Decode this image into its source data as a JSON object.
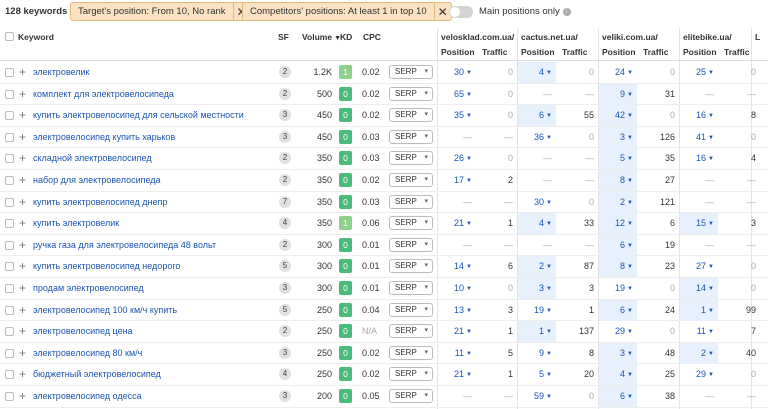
{
  "toolbar": {
    "keywords_count": "128 keywords",
    "filter1": "Target's position: From 10, No rank",
    "filter2": "Competitors' positions: At least 1 in top 10",
    "main_positions_label": "Main positions only",
    "main_positions_on": false
  },
  "columns": {
    "keyword": "Keyword",
    "sf": "SF",
    "volume": "Volume",
    "kd": "KD",
    "cpc": "CPC",
    "position": "Position",
    "traffic": "Traffic",
    "competitors": [
      "velosklad.com.ua/",
      "cactus.net.ua/",
      "veliki.com.ua/",
      "elitebike.ua/",
      "L"
    ]
  },
  "colors": {
    "kd_green": "#4bbb7c",
    "kd_lightgreen": "#8fd08f",
    "highlight": "#e6f1fd",
    "link": "#1a55b3"
  },
  "rows": [
    {
      "kw": "электровелик",
      "sf": "2",
      "vol": "1.2K",
      "kd": "1",
      "kdc": "lg",
      "cpc": "0.02",
      "serp": "SERP",
      "c": [
        [
          "30",
          0,
          "0"
        ],
        [
          "4",
          1,
          "0"
        ],
        [
          "24",
          0,
          "0"
        ],
        [
          "25",
          0,
          "0"
        ],
        [
          "",
          0,
          ""
        ]
      ]
    },
    {
      "kw": "комплект для электровелосипеда",
      "sf": "2",
      "vol": "500",
      "kd": "0",
      "kdc": "g",
      "cpc": "0.02",
      "serp": "SERP",
      "c": [
        [
          "65",
          0,
          "0"
        ],
        [
          "—",
          0,
          "—"
        ],
        [
          "9",
          1,
          "31"
        ],
        [
          "—",
          0,
          "—"
        ],
        [
          "",
          0,
          ""
        ]
      ]
    },
    {
      "kw": "купить электровелосипед для сельской местности",
      "sf": "3",
      "vol": "450",
      "kd": "0",
      "kdc": "g",
      "cpc": "0.02",
      "serp": "SERP",
      "c": [
        [
          "35",
          0,
          "0"
        ],
        [
          "6",
          1,
          "55"
        ],
        [
          "42",
          1,
          "0"
        ],
        [
          "16",
          0,
          "8"
        ],
        [
          "",
          0,
          ""
        ]
      ]
    },
    {
      "kw": "электровелосипед купить харьков",
      "sf": "3",
      "vol": "450",
      "kd": "0",
      "kdc": "g",
      "cpc": "0.03",
      "serp": "SERP",
      "c": [
        [
          "—",
          0,
          "—"
        ],
        [
          "36",
          0,
          "0"
        ],
        [
          "3",
          1,
          "126"
        ],
        [
          "41",
          0,
          "0"
        ],
        [
          "",
          0,
          ""
        ]
      ]
    },
    {
      "kw": "складной электровелосипед",
      "sf": "2",
      "vol": "350",
      "kd": "0",
      "kdc": "g",
      "cpc": "0.03",
      "serp": "SERP",
      "c": [
        [
          "26",
          0,
          "0"
        ],
        [
          "—",
          0,
          "—"
        ],
        [
          "5",
          1,
          "35"
        ],
        [
          "16",
          0,
          "4"
        ],
        [
          "",
          0,
          ""
        ]
      ]
    },
    {
      "kw": "набор для электровелосипеда",
      "sf": "2",
      "vol": "350",
      "kd": "0",
      "kdc": "g",
      "cpc": "0.02",
      "serp": "SERP",
      "c": [
        [
          "17",
          0,
          "2"
        ],
        [
          "—",
          0,
          "—"
        ],
        [
          "8",
          1,
          "27"
        ],
        [
          "—",
          0,
          "—"
        ],
        [
          "",
          0,
          ""
        ]
      ]
    },
    {
      "kw": "купить электровелосипед днепр",
      "sf": "7",
      "vol": "350",
      "kd": "0",
      "kdc": "g",
      "cpc": "0.03",
      "serp": "SERP",
      "c": [
        [
          "—",
          0,
          "—"
        ],
        [
          "30",
          0,
          "0"
        ],
        [
          "2",
          1,
          "121"
        ],
        [
          "—",
          0,
          "—"
        ],
        [
          "",
          0,
          ""
        ]
      ]
    },
    {
      "kw": "купить электровелик",
      "sf": "4",
      "vol": "350",
      "kd": "1",
      "kdc": "lg",
      "cpc": "0.06",
      "serp": "SERP",
      "c": [
        [
          "21",
          0,
          "1"
        ],
        [
          "4",
          1,
          "33"
        ],
        [
          "12",
          1,
          "6"
        ],
        [
          "15",
          1,
          "3"
        ],
        [
          "",
          0,
          ""
        ]
      ]
    },
    {
      "kw": "ручка газа для электровелосипеда 48 вольт",
      "sf": "2",
      "vol": "300",
      "kd": "0",
      "kdc": "g",
      "cpc": "0.01",
      "serp": "SERP",
      "c": [
        [
          "—",
          0,
          "—"
        ],
        [
          "—",
          0,
          "—"
        ],
        [
          "6",
          1,
          "19"
        ],
        [
          "—",
          0,
          "—"
        ],
        [
          "",
          0,
          ""
        ]
      ]
    },
    {
      "kw": "купить электровелосипед недорого",
      "sf": "5",
      "vol": "300",
      "kd": "0",
      "kdc": "g",
      "cpc": "0.01",
      "serp": "SERP",
      "c": [
        [
          "14",
          0,
          "6"
        ],
        [
          "2",
          1,
          "87"
        ],
        [
          "8",
          1,
          "23"
        ],
        [
          "27",
          0,
          "0"
        ],
        [
          "",
          0,
          ""
        ]
      ]
    },
    {
      "kw": "продам электровелосипед",
      "sf": "3",
      "vol": "300",
      "kd": "0",
      "kdc": "g",
      "cpc": "0.01",
      "serp": "SERP",
      "c": [
        [
          "10",
          0,
          "0"
        ],
        [
          "3",
          1,
          "3"
        ],
        [
          "19",
          0,
          "0"
        ],
        [
          "14",
          1,
          "0"
        ],
        [
          "",
          0,
          ""
        ]
      ]
    },
    {
      "kw": "электровелосипед 100 км/ч купить",
      "sf": "5",
      "vol": "250",
      "kd": "0",
      "kdc": "g",
      "cpc": "0.04",
      "serp": "SERP",
      "c": [
        [
          "13",
          0,
          "3"
        ],
        [
          "19",
          0,
          "1"
        ],
        [
          "6",
          1,
          "24"
        ],
        [
          "1",
          1,
          "99"
        ],
        [
          "",
          0,
          ""
        ]
      ]
    },
    {
      "kw": "электровелосипед цена",
      "sf": "2",
      "vol": "250",
      "kd": "0",
      "kdc": "g",
      "cpc": "N/A",
      "serp": "SERP",
      "c": [
        [
          "21",
          0,
          "1"
        ],
        [
          "1",
          1,
          "137"
        ],
        [
          "29",
          0,
          "0"
        ],
        [
          "11",
          0,
          "7"
        ],
        [
          "",
          0,
          ""
        ]
      ]
    },
    {
      "kw": "электровелосипед 80 км/ч",
      "sf": "3",
      "vol": "250",
      "kd": "0",
      "kdc": "g",
      "cpc": "0.02",
      "serp": "SERP",
      "c": [
        [
          "11",
          0,
          "5"
        ],
        [
          "9",
          0,
          "8"
        ],
        [
          "3",
          1,
          "48"
        ],
        [
          "2",
          1,
          "40"
        ],
        [
          "",
          0,
          ""
        ]
      ]
    },
    {
      "kw": "бюджетный электровелосипед",
      "sf": "4",
      "vol": "250",
      "kd": "0",
      "kdc": "g",
      "cpc": "0.02",
      "serp": "SERP",
      "c": [
        [
          "21",
          0,
          "1"
        ],
        [
          "5",
          0,
          "20"
        ],
        [
          "4",
          1,
          "25"
        ],
        [
          "29",
          0,
          "0"
        ],
        [
          "",
          0,
          ""
        ]
      ]
    },
    {
      "kw": "электровелосипед одесса",
      "sf": "3",
      "vol": "200",
      "kd": "0",
      "kdc": "g",
      "cpc": "0.05",
      "serp": "SERP",
      "c": [
        [
          "—",
          0,
          "—"
        ],
        [
          "59",
          0,
          "0"
        ],
        [
          "6",
          1,
          "38"
        ],
        [
          "—",
          0,
          "—"
        ],
        [
          "",
          0,
          ""
        ]
      ]
    }
  ]
}
